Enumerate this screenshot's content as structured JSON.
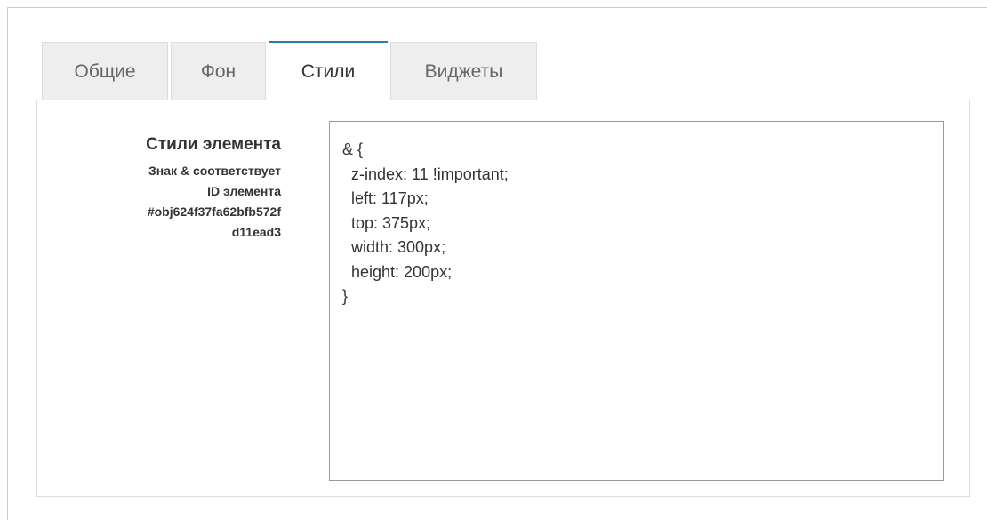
{
  "tabs": [
    {
      "label": "Общие",
      "active": false
    },
    {
      "label": "Фон",
      "active": false
    },
    {
      "label": "Стили",
      "active": true
    },
    {
      "label": "Виджеты",
      "active": false
    }
  ],
  "styles": {
    "title": "Стили элемента",
    "hint_lines": [
      "Знак & соответствует",
      "ID элемента",
      "#obj624f37fa62bfb572f",
      "d11ead3"
    ],
    "editor_value": "& {\n  z-index: 11 !important;\n  left: 117px;\n  top: 375px;\n  width: 300px;\n  height: 200px;\n}"
  },
  "colors": {
    "active_tab_accent": "#2a7ab0",
    "tab_background": "#eeeeee",
    "border": "#dddddd"
  }
}
